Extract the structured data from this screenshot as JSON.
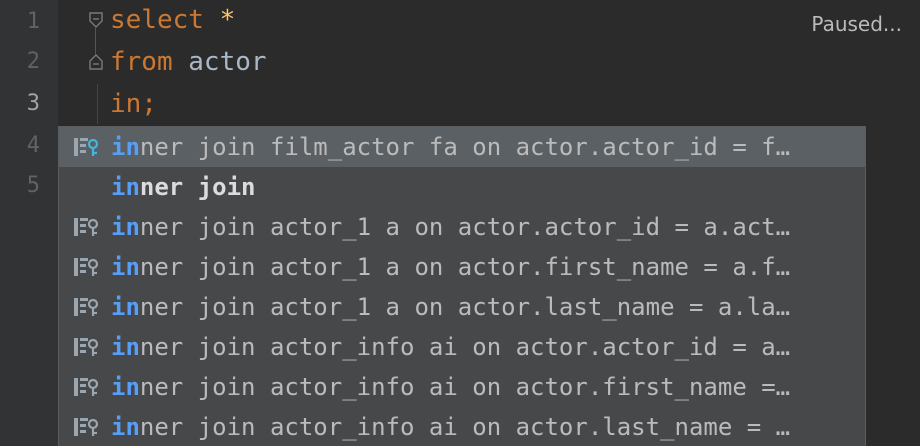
{
  "status": "Paused...",
  "gutter": {
    "line_numbers": [
      "1",
      "2",
      "3",
      "4",
      "5"
    ]
  },
  "code": {
    "line1": {
      "keyword": "select",
      "star": "*"
    },
    "line2": {
      "keyword": "from",
      "identifier": "actor"
    },
    "line3": {
      "typed": "in;"
    }
  },
  "completion": {
    "typed_prefix": "in",
    "items": [
      {
        "prefix": "in",
        "rest": "ner join film_actor fa on actor.actor_id = f…",
        "icon": "table-key-icon",
        "selected": true
      },
      {
        "prefix": "in",
        "rest": "ner join",
        "icon": "",
        "keyword": true
      },
      {
        "prefix": "in",
        "rest": "ner join actor_1 a on actor.actor_id = a.act…",
        "icon": "table-key-icon"
      },
      {
        "prefix": "in",
        "rest": "ner join actor_1 a on actor.first_name = a.f…",
        "icon": "table-key-icon"
      },
      {
        "prefix": "in",
        "rest": "ner join actor_1 a on actor.last_name = a.la…",
        "icon": "table-key-icon"
      },
      {
        "prefix": "in",
        "rest": "ner join actor_info ai on actor.actor_id = a…",
        "icon": "table-key-icon"
      },
      {
        "prefix": "in",
        "rest": "ner join actor_info ai on actor.first_name =…",
        "icon": "table-key-icon"
      },
      {
        "prefix": "in",
        "rest": "ner join actor_info ai on actor.last_name = …",
        "icon": "table-key-icon"
      }
    ]
  },
  "colors": {
    "background": "#2b2b2b",
    "gutter": "#313335",
    "keyword": "#cc7832",
    "match": "#589df6",
    "popup": "#46484a",
    "selected": "#5b6064"
  }
}
